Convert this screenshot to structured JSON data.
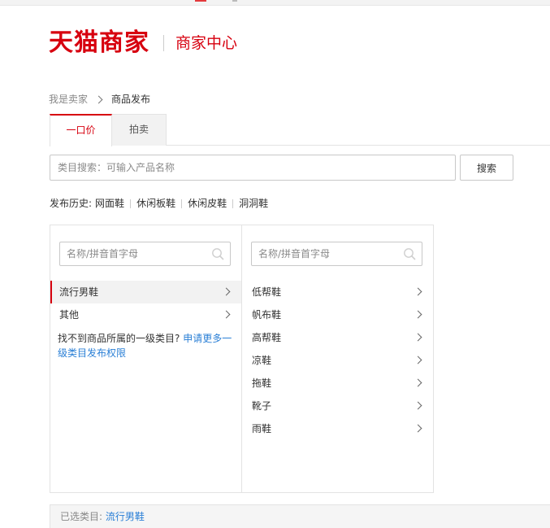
{
  "header": {
    "logo_text": "天猫商家",
    "title": "商家中心"
  },
  "breadcrumb": {
    "home": "我是卖家",
    "current": "商品发布"
  },
  "tabs": [
    {
      "label": "一口价",
      "active": true
    },
    {
      "label": "拍卖",
      "active": false
    }
  ],
  "search": {
    "placeholder": "类目搜索：可输入产品名称",
    "button_label": "搜索"
  },
  "history": {
    "label": "发布历史:",
    "items": [
      "网面鞋",
      "休闲板鞋",
      "休闲皮鞋",
      "洞洞鞋"
    ]
  },
  "category_col1": {
    "search_placeholder": "名称/拼音首字母",
    "items": [
      {
        "label": "流行男鞋",
        "selected": true
      },
      {
        "label": "其他",
        "selected": false
      }
    ],
    "no_category_text": "找不到商品所属的一级类目?",
    "no_category_link": "申请更多一级类目发布权限"
  },
  "category_col2": {
    "search_placeholder": "名称/拼音首字母",
    "items": [
      "低帮鞋",
      "帆布鞋",
      "高帮鞋",
      "凉鞋",
      "拖鞋",
      "靴子",
      "雨鞋"
    ]
  },
  "selected_category": {
    "label": "已选类目:",
    "value": "流行男鞋"
  },
  "colors": {
    "brand_red": "#d7000f",
    "link_blue": "#2a7fd6"
  }
}
